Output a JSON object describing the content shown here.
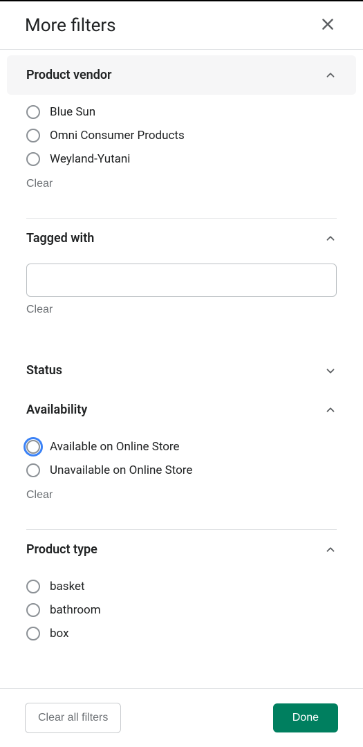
{
  "header": {
    "title": "More filters"
  },
  "sections": {
    "vendor": {
      "title": "Product vendor",
      "options": [
        "Blue Sun",
        "Omni Consumer Products",
        "Weyland-Yutani"
      ],
      "clear": "Clear"
    },
    "tagged": {
      "title": "Tagged with",
      "value": "",
      "clear": "Clear"
    },
    "status": {
      "title": "Status"
    },
    "availability": {
      "title": "Availability",
      "options": [
        "Available on Online Store",
        "Unavailable on Online Store"
      ],
      "clear": "Clear"
    },
    "type": {
      "title": "Product type",
      "options": [
        "basket",
        "bathroom",
        "box"
      ]
    }
  },
  "footer": {
    "clear_all": "Clear all filters",
    "done": "Done"
  },
  "colors": {
    "primary": "#007f5f",
    "focus": "#3b82f6"
  }
}
